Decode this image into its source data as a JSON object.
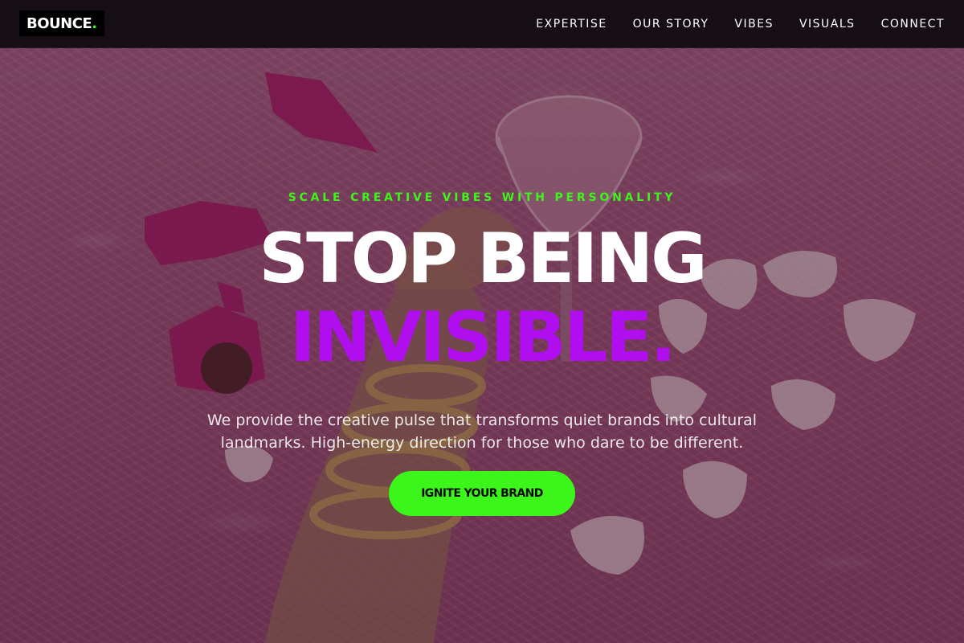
{
  "header": {
    "logo_text": "BOUNCE",
    "logo_dot": ".",
    "nav": [
      {
        "label": "EXPERTISE"
      },
      {
        "label": "OUR STORY"
      },
      {
        "label": "VIBES"
      },
      {
        "label": "VISUALS"
      },
      {
        "label": "CONNECT"
      }
    ]
  },
  "hero": {
    "eyebrow": "SCALE CREATIVE VIBES WITH PERSONALITY",
    "headline_line1": "STOP BEING",
    "headline_line2": "INVISIBLE.",
    "subtitle": "We provide the creative pulse that transforms quiet brands into cultural landmarks. High-energy direction for those who dare to be different.",
    "cta_label": "IGNITE YOUR BRAND",
    "background_image": "photo of a hand with gold chain bracelets holding a pink drink glass on a pink fluffy rug with wrapped chocolates and white petals"
  },
  "colors": {
    "accent_green": "#3cf51a",
    "accent_purple": "#b10ef0",
    "header_bg": "#120c12",
    "rug_pink": "#b56a8e"
  }
}
